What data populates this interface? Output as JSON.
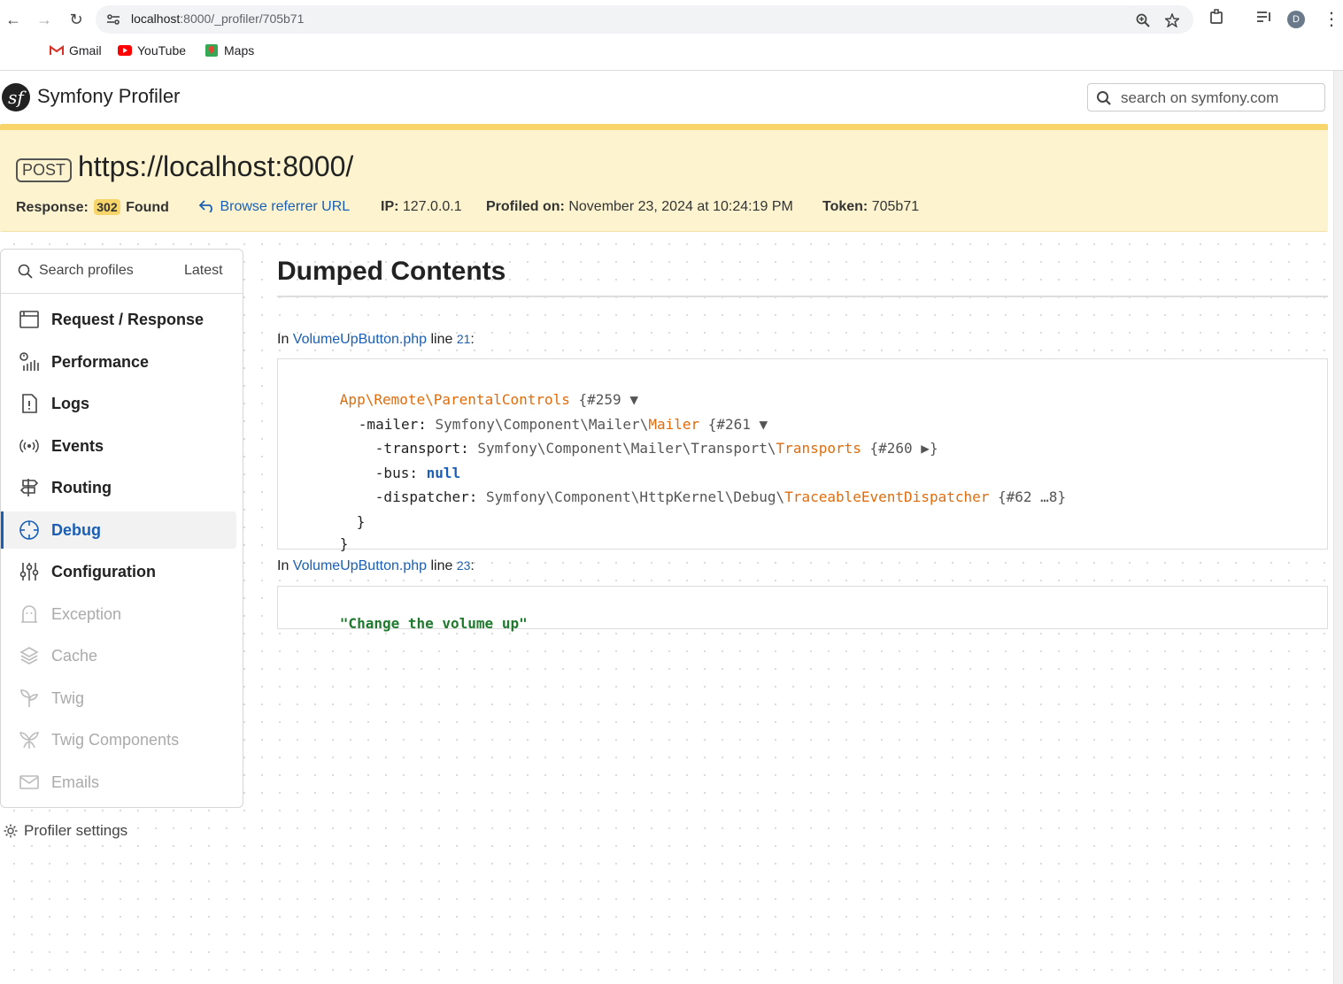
{
  "browser": {
    "url_host": "localhost",
    "url_rest": ":8000/_profiler/705b71",
    "avatar_letter": "D",
    "bookmarks": [
      {
        "label": "Gmail",
        "icon": "gmail-icon"
      },
      {
        "label": "YouTube",
        "icon": "youtube-icon"
      },
      {
        "label": "Maps",
        "icon": "maps-icon"
      }
    ]
  },
  "header": {
    "brand": "Symfony Profiler",
    "search_placeholder": "search on symfony.com"
  },
  "summary": {
    "method": "POST",
    "url": "https://localhost:8000/",
    "response_label": "Response:",
    "status_code": "302",
    "status_text": "Found",
    "referrer_link": "Browse referrer URL",
    "ip_label": "IP:",
    "ip": "127.0.0.1",
    "profiled_label": "Profiled on:",
    "profiled_on": "November 23, 2024 at 10:24:19 PM",
    "token_label": "Token:",
    "token": "705b71"
  },
  "sidebar": {
    "search_label": "Search profiles",
    "latest": "Latest",
    "items": [
      {
        "label": "Request / Response",
        "icon": "request-response-icon",
        "enabled": true
      },
      {
        "label": "Performance",
        "icon": "performance-icon",
        "enabled": true
      },
      {
        "label": "Logs",
        "icon": "logs-icon",
        "enabled": true
      },
      {
        "label": "Events",
        "icon": "events-icon",
        "enabled": true
      },
      {
        "label": "Routing",
        "icon": "routing-icon",
        "enabled": true
      },
      {
        "label": "Debug",
        "icon": "debug-icon",
        "enabled": true,
        "active": true
      },
      {
        "label": "Configuration",
        "icon": "configuration-icon",
        "enabled": true
      },
      {
        "label": "Exception",
        "icon": "exception-icon",
        "enabled": false
      },
      {
        "label": "Cache",
        "icon": "cache-icon",
        "enabled": false
      },
      {
        "label": "Twig",
        "icon": "twig-icon",
        "enabled": false
      },
      {
        "label": "Twig Components",
        "icon": "twig-components-icon",
        "enabled": false
      },
      {
        "label": "Emails",
        "icon": "emails-icon",
        "enabled": false
      }
    ],
    "settings": "Profiler settings"
  },
  "main": {
    "title": "Dumped Contents",
    "dumps": [
      {
        "in": "In",
        "file": "VolumeUpButton.php",
        "line_word": "line",
        "line": "21",
        "lines": [
          {
            "ns": "App\\Remote\\",
            "cls": "ParentalControls",
            "tail": " {#259 ▼"
          },
          {
            "prop": "-mailer: ",
            "ns": "Symfony\\Component\\Mailer\\",
            "cls": "Mailer",
            "tail": " {#261 ▼"
          },
          {
            "prop": "-transport: ",
            "ns": "Symfony\\Component\\Mailer\\Transport\\",
            "cls": "Transports",
            "tail": " {#260 ▶}"
          },
          {
            "prop": "-bus: ",
            "value": "null"
          },
          {
            "prop": "-dispatcher: ",
            "ns": "Symfony\\Component\\HttpKernel\\Debug\\",
            "cls": "TraceableEventDispatcher",
            "tail": " {#62 …8}"
          },
          {
            "close": "}"
          },
          {
            "close": "}"
          }
        ]
      },
      {
        "in": "In",
        "file": "VolumeUpButton.php",
        "line_word": "line",
        "line": "23",
        "string": "\"Change the volume up\""
      }
    ]
  }
}
